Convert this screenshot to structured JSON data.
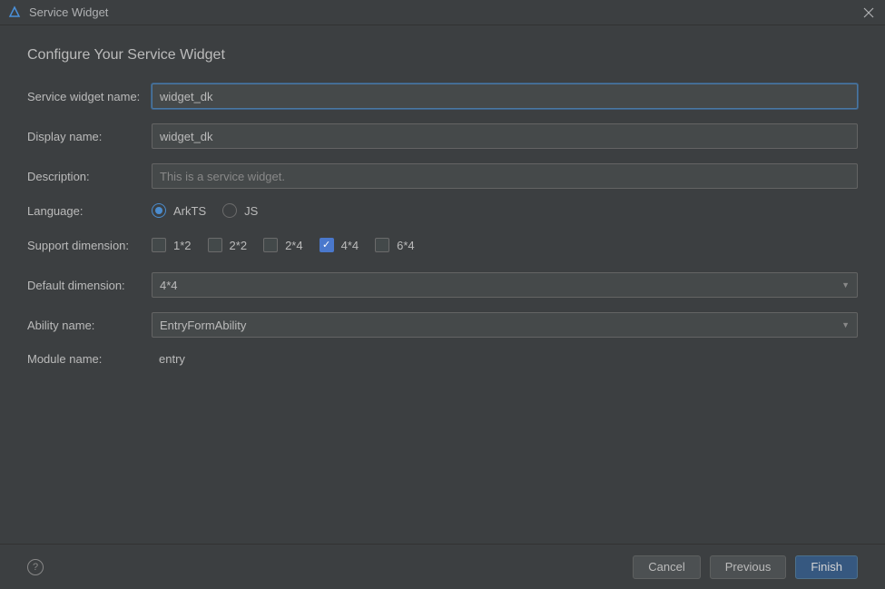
{
  "titlebar": {
    "title": "Service Widget"
  },
  "page": {
    "title": "Configure Your Service Widget"
  },
  "form": {
    "widget_name": {
      "label": "Service widget name:",
      "value": "widget_dk"
    },
    "display_name": {
      "label": "Display name:",
      "value": "widget_dk"
    },
    "description": {
      "label": "Description:",
      "value": "This is a service widget."
    },
    "language": {
      "label": "Language:",
      "options": {
        "arkts": "ArkTS",
        "js": "JS"
      }
    },
    "dimension": {
      "label": "Support dimension:",
      "opt_1x2": "1*2",
      "opt_2x2": "2*2",
      "opt_2x4": "2*4",
      "opt_4x4": "4*4",
      "opt_6x4": "6*4"
    },
    "default_dimension": {
      "label": "Default dimension:",
      "value": "4*4"
    },
    "ability": {
      "label": "Ability name:",
      "value": "EntryFormAbility"
    },
    "module": {
      "label": "Module name:",
      "value": "entry"
    }
  },
  "footer": {
    "cancel": "Cancel",
    "previous": "Previous",
    "finish": "Finish"
  }
}
